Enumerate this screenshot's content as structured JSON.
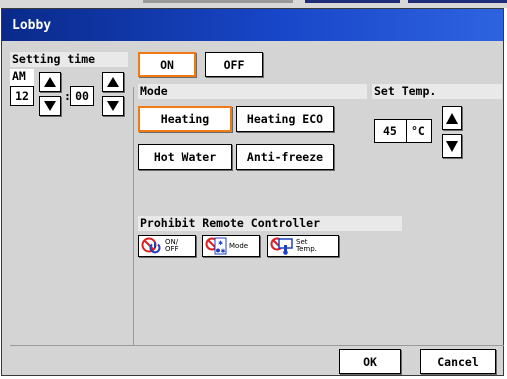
{
  "window": {
    "title": "Lobby"
  },
  "setting_time": {
    "label": "Setting time",
    "ampm": "AM",
    "hour": "12",
    "separator": ":",
    "minute": "00"
  },
  "power": {
    "on_label": "ON",
    "off_label": "OFF",
    "selected": "ON"
  },
  "mode": {
    "label": "Mode",
    "options": [
      "Heating",
      "Heating ECO",
      "Hot Water",
      "Anti-freeze"
    ],
    "selected": "Heating"
  },
  "set_temp": {
    "label": "Set Temp.",
    "value": "45",
    "unit": "°C"
  },
  "prohibit": {
    "label": "Prohibit Remote Controller",
    "buttons": [
      {
        "line1": "ON/",
        "line2": "OFF",
        "icon": "power-prohibit-icon"
      },
      {
        "line1": "Mode",
        "line2": "",
        "icon": "mode-prohibit-icon"
      },
      {
        "line1": "Set",
        "line2": "Temp.",
        "icon": "thermometer-prohibit-icon"
      }
    ]
  },
  "footer": {
    "ok_label": "OK",
    "cancel_label": "Cancel"
  },
  "colors": {
    "title_start": "#0a2a8a",
    "title_end": "#2e63e0",
    "selection": "#f07a14",
    "panel": "#d4d4d4",
    "prohibit_red": "#e02020",
    "icon_blue": "#2040c0"
  }
}
